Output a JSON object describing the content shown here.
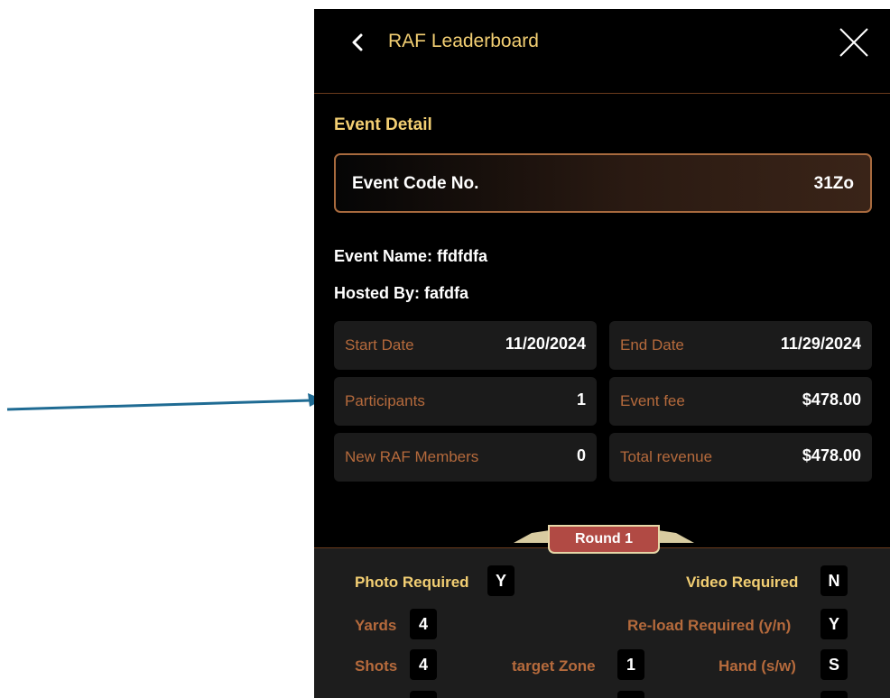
{
  "header": {
    "title": "RAF Leaderboard",
    "back_icon": "chevron-left-icon",
    "close_icon": "close-icon"
  },
  "event_detail": {
    "section_title": "Event Detail",
    "code_label": "Event Code No.",
    "code_value": "31Zo",
    "event_name": "Event Name: ffdfdfa",
    "hosted_by": "Hosted By: fafdfa"
  },
  "stats": {
    "start_date": {
      "label": "Start Date",
      "value": "11/20/2024"
    },
    "end_date": {
      "label": "End Date",
      "value": "11/29/2024"
    },
    "participants": {
      "label": "Participants",
      "value": "1"
    },
    "event_fee": {
      "label": "Event fee",
      "value": "$478.00"
    },
    "new_members": {
      "label": "New RAF Members",
      "value": "0"
    },
    "total_revenue": {
      "label": "Total revenue",
      "value": "$478.00"
    }
  },
  "round": {
    "badge": "Round 1",
    "photo_required": {
      "label": "Photo Required",
      "value": "Y"
    },
    "video_required": {
      "label": "Video Required",
      "value": "N"
    },
    "yards": {
      "label": "Yards",
      "value": "4"
    },
    "reload_required": {
      "label": "Re-load Required (y/n)",
      "value": "Y"
    },
    "shots": {
      "label": "Shots",
      "value": "4"
    },
    "target_zone": {
      "label": "target Zone",
      "value": "1"
    },
    "hand": {
      "label": "Hand (s/w)",
      "value": "S"
    }
  },
  "annotation": {
    "arrow_color": "#1f6b93",
    "arrow_target": "Participants"
  },
  "colors": {
    "accent_gold": "#f3cf73",
    "label_copper": "#b56a3c",
    "badge_red": "#b14a44"
  }
}
